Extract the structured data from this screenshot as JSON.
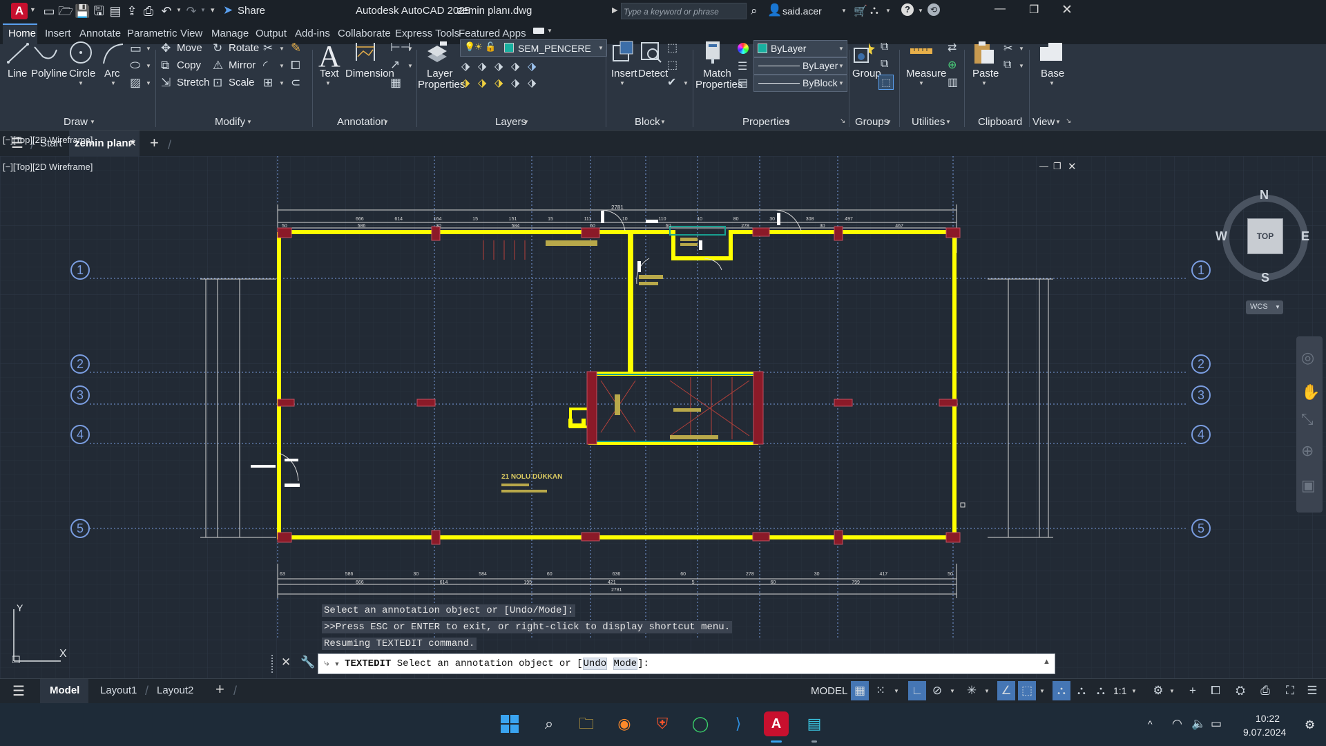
{
  "titlebar": {
    "app_badge": "A",
    "share_label": "Share",
    "title": "Autodesk AutoCAD 2025",
    "filename": "zemin planı.dwg",
    "search_placeholder": "Type a keyword or phrase",
    "user": "said.acer"
  },
  "ribbon_tabs": [
    "Home",
    "Insert",
    "Annotate",
    "Parametric",
    "View",
    "Manage",
    "Output",
    "Add-ins",
    "Collaborate",
    "Express Tools",
    "Featured Apps"
  ],
  "draw": {
    "line": "Line",
    "polyline": "Polyline",
    "circle": "Circle",
    "arc": "Arc",
    "title": "Draw"
  },
  "modify": {
    "move": "Move",
    "rotate": "Rotate",
    "copy": "Copy",
    "mirror": "Mirror",
    "stretch": "Stretch",
    "scale": "Scale",
    "title": "Modify"
  },
  "annotation": {
    "text": "Text",
    "dimension": "Dimension",
    "title": "Annotation"
  },
  "layers": {
    "layer_properties_1": "Layer",
    "layer_properties_2": "Properties",
    "current_layer": "SEM_PENCERE",
    "title": "Layers"
  },
  "block": {
    "insert": "Insert",
    "detect": "Detect",
    "title": "Block"
  },
  "properties": {
    "match_1": "Match",
    "match_2": "Properties",
    "color": "ByLayer",
    "linetype": "ByLayer",
    "lineweight": "ByBlock",
    "title": "Properties"
  },
  "groups": {
    "group": "Group",
    "title": "Groups"
  },
  "utilities": {
    "measure": "Measure",
    "title": "Utilities"
  },
  "clipboard": {
    "paste": "Paste",
    "title": "Clipboard"
  },
  "view": {
    "base": "Base",
    "title": "View"
  },
  "file_tabs": {
    "start": "Start",
    "current": "zemin planı*"
  },
  "viewport": {
    "label": "[−][Top][2D Wireframe]",
    "compass": {
      "n": "N",
      "s": "S",
      "e": "E",
      "w": "W",
      "top": "TOP",
      "wcs": "WCS"
    },
    "grid_labels": [
      "1",
      "2",
      "3",
      "4",
      "5"
    ],
    "room_label": "21 NOLU DÜKKAN",
    "top_dims_total": "2781",
    "top_dims_row1": [
      "666",
      "614",
      "164",
      "15",
      "151",
      "15",
      "111",
      "10",
      "110",
      "10",
      "80",
      "30",
      "308",
      "497"
    ],
    "top_dims_row2": [
      "50",
      "586",
      "30",
      "584",
      "60",
      "60",
      "278",
      "30",
      "467"
    ],
    "bottom_dims_row1": [
      "63",
      "586",
      "30",
      "584",
      "60",
      "636",
      "60",
      "278",
      "30",
      "417",
      "50"
    ],
    "bottom_dims_row2": [
      "666",
      "614",
      "195",
      "421",
      "5",
      "60",
      "799"
    ],
    "bottom_total": "2781",
    "ucs_y": "Y",
    "ucs_x": "X"
  },
  "command": {
    "history": [
      "Select an annotation object or [Undo/Mode]:",
      ">>Press ESC or ENTER to exit, or right-click to display shortcut menu.",
      "Resuming TEXTEDIT command."
    ],
    "prompt_cmd": "TEXTEDIT",
    "prompt_text": "Select an annotation object or [",
    "opt1": "Undo",
    "opt2": "Mode",
    "prompt_end": "]:"
  },
  "status": {
    "model_tab": "Model",
    "layout1": "Layout1",
    "layout2": "Layout2",
    "model": "MODEL",
    "scale": "1:1"
  },
  "taskbar": {
    "time": "10:22",
    "date": "9.07.2024"
  },
  "colors": {
    "wall": "#ffff00",
    "column": "#8b1a28",
    "grid_line": "#7a9de0",
    "dim": "#d8d8d8",
    "accent": "#c8102e"
  }
}
